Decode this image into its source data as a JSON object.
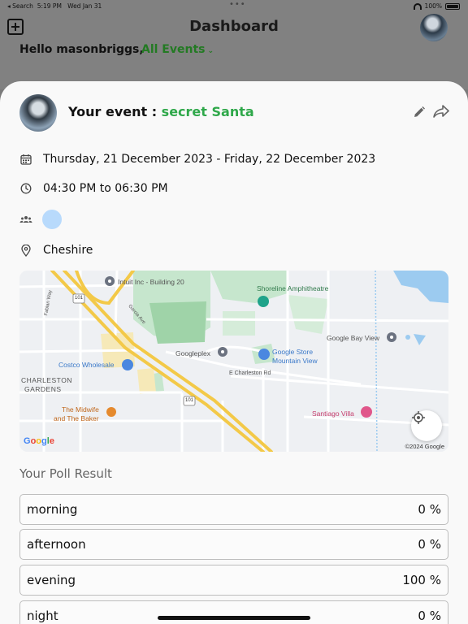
{
  "status_bar": {
    "back_label": "◂ Search",
    "time": "5:19 PM",
    "date": "Wed Jan 31",
    "battery": "100%"
  },
  "header": {
    "title": "Dashboard",
    "greeting": "Hello masonbriggs,",
    "filter": "All Events"
  },
  "event": {
    "prefix": "Your event : ",
    "name": "secret Santa",
    "dates": "Thursday, 21 December 2023 - Friday, 22 December 2023",
    "time": "04:30 PM to 06:30 PM",
    "location": "Cheshire"
  },
  "map": {
    "labels": {
      "intuit": "Intuit Inc - Building 20",
      "shoreline": "Shoreline Amphitheatre",
      "google_bay_view": "Google Bay View",
      "googleplex": "Googleplex",
      "google_store": "Google Store",
      "mountain_view": "Mountain View",
      "costco": "Costco Wholesale",
      "charleston_road": "E Charleston Rd",
      "charleston_gardens_1": "CHARLESTON",
      "charleston_gardens_2": "GARDENS",
      "midwife_1": "The Midwife",
      "midwife_2": "and The Baker",
      "santiago": "Santiago Villa",
      "fabian": "Fabian Way",
      "garcia": "Garcia Ave",
      "hwy_101": "101"
    },
    "logo": "Google",
    "copyright": "©2024 Google"
  },
  "poll": {
    "title": "Your Poll Result",
    "options": [
      {
        "label": "morning",
        "percent": "0 %"
      },
      {
        "label": "afternoon",
        "percent": "0 %"
      },
      {
        "label": "evening",
        "percent": "100 %"
      },
      {
        "label": "night",
        "percent": "0 %"
      }
    ]
  },
  "colors": {
    "accent_green": "#2fa84a",
    "filter_green": "#237a23",
    "attendee_dot": "#b8dafc"
  },
  "icons": [
    "add-icon",
    "avatar",
    "edit-icon",
    "share-icon",
    "calendar-icon",
    "clock-icon",
    "group-icon",
    "location-pin-icon",
    "my-location-icon"
  ]
}
